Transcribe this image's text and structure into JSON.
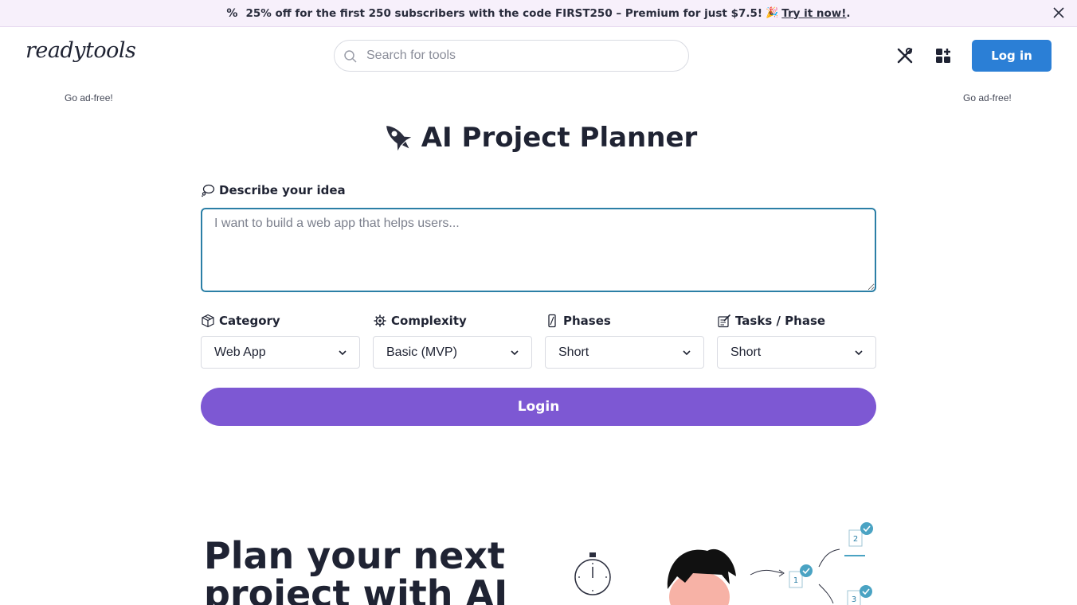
{
  "promo": {
    "text": "25% off for the first 250 subscribers with the code FIRST250 – Premium for just $7.5!",
    "link": "Try it now!",
    "suffix": "."
  },
  "header": {
    "logo": "readytools",
    "search_placeholder": "Search for tools",
    "login_label": "Log in"
  },
  "ads": {
    "left": "Go ad-free!",
    "right": "Go ad-free!"
  },
  "page": {
    "title": "AI Project Planner"
  },
  "form": {
    "idea_label": "Describe your idea",
    "idea_placeholder": "I want to build a web app that helps users...",
    "fields": [
      {
        "label": "Category",
        "value": "Web App"
      },
      {
        "label": "Complexity",
        "value": "Basic (MVP)"
      },
      {
        "label": "Phases",
        "value": "Short"
      },
      {
        "label": "Tasks / Phase",
        "value": "Short"
      }
    ],
    "submit_label": "Login"
  },
  "hero": {
    "line1": "Plan your next",
    "line2": "project with AI"
  },
  "colors": {
    "primary": "#2b7fd6",
    "accent": "#7d58d3",
    "banner": "#f7f0fb"
  }
}
